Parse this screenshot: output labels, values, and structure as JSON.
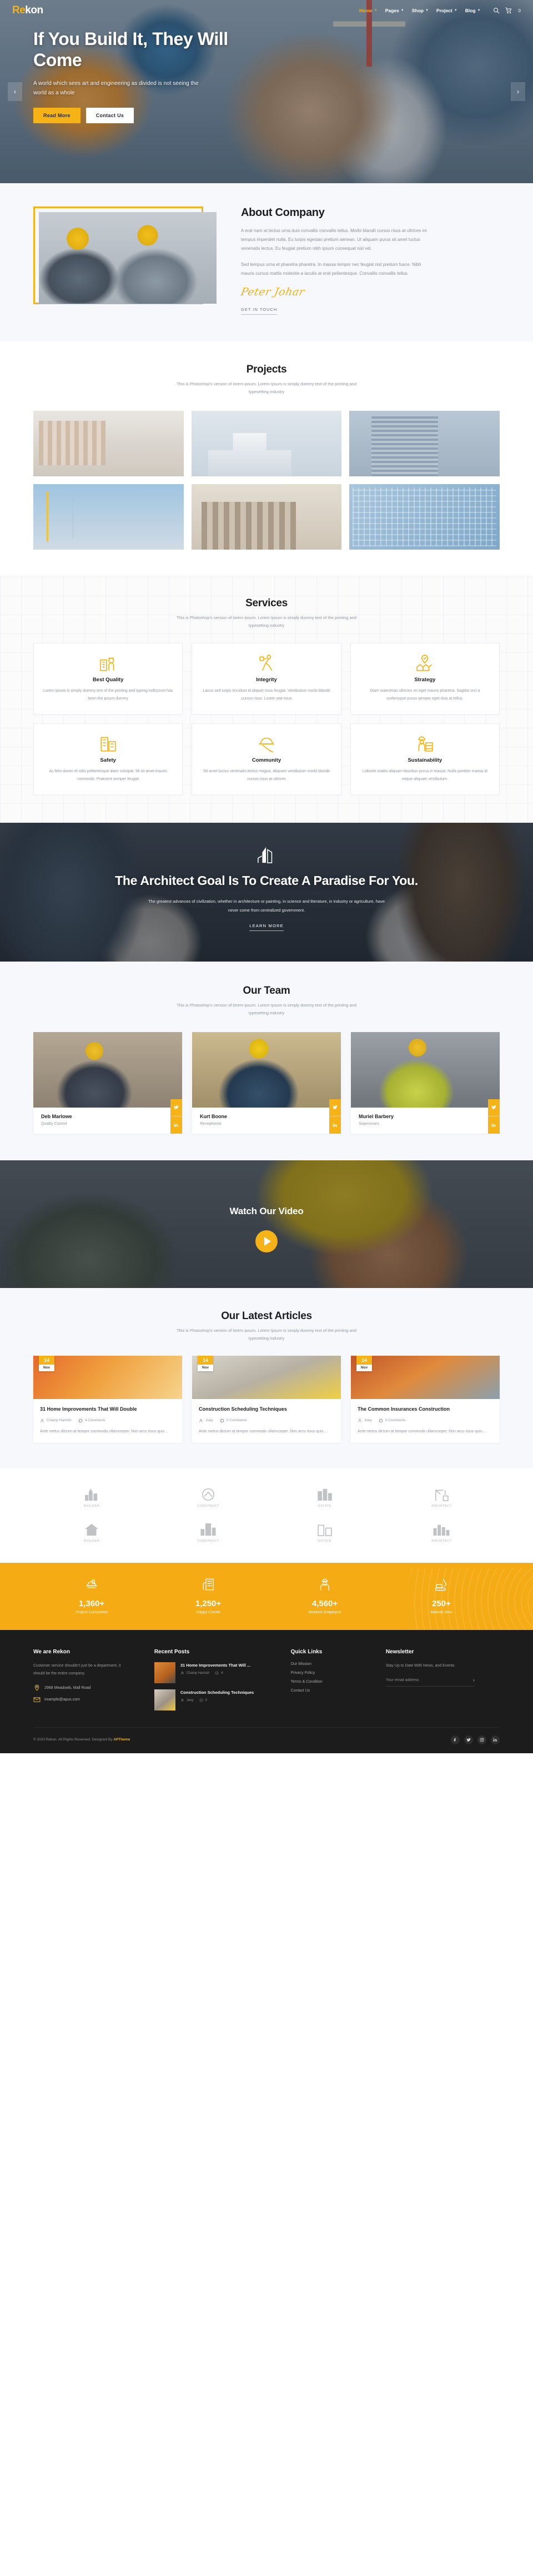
{
  "site": {
    "logo_re": "Re",
    "logo_kon": "kon"
  },
  "nav": {
    "items": [
      {
        "label": "Home",
        "has_caret": true,
        "active": true
      },
      {
        "label": "Pages",
        "has_caret": true,
        "active": false
      },
      {
        "label": "Shop",
        "has_caret": true,
        "active": false
      },
      {
        "label": "Project",
        "has_caret": true,
        "active": false
      },
      {
        "label": "Blog",
        "has_caret": true,
        "active": false
      }
    ],
    "search_icon": "search-icon",
    "cart_icon": "cart-icon",
    "cart_count": "0"
  },
  "hero": {
    "title": "If You Build It, They Will Come",
    "subtitle": "A world which sees art and engineering as divided is not seeing the world as a whole",
    "primary_button": "Read More",
    "secondary_button": "Contact Us",
    "prev_icon": "chevron-left-icon",
    "next_icon": "chevron-right-icon"
  },
  "about": {
    "title": "About Company",
    "paragraph1": "A erat nam at lectus urna duis convallis convallis tellus. Morbi blandit cursus risus at ultrices mi tempus imperdiet nulla. Eu turpis egestas pretium aenean. Ut aliquam purus sit amet luctus venenatis lectus. Eu feugiat pretium nibh ipsum consequat nisl vel.",
    "paragraph2": "Sed tempus urna et pharetra pharetra. In massa tempor nec feugiat nisl pretium fusce. Nibh mauris cursus mattis molestie a iaculis at erat pellentesque. Convallis convallis tellus.",
    "signature": "Peter Johar",
    "link": "GET IN TOUCH"
  },
  "projects": {
    "title": "Projects",
    "subtitle": "This is Photoshop's version of lorem ipsum. Lorem Ipsum is simply dummy text of the printing and typesetting industry"
  },
  "services": {
    "title": "Services",
    "subtitle": "This is Photoshop's version of lorem ipsum. Lorem Ipsum is simply dummy text of the printing and typesetting industry",
    "items": [
      {
        "icon": "engineer-building-icon",
        "name": "Best Quality",
        "text": "Lorem ipsum is simply dummy text of the printing and typesg indtrysum has been the ipsum dummy"
      },
      {
        "icon": "worker-shovel-icon",
        "name": "Integrity",
        "text": "Lacus sed turpis tincidunt id aliquet risus feugiat. Vestibulum morbi blandit cursus risus. Lorem sed risus"
      },
      {
        "icon": "location-houses-icon",
        "name": "Strategy",
        "text": "Diam maecenas ultricies mi eget mauris pharetra. Sagittis orci a scelerisque purus semper eget duis at tellus."
      },
      {
        "icon": "buildings-icon",
        "name": "Safety",
        "text": "Ac felis donec et odio pellentesque diam volutpat. Mi sit amet mauris commodo. Praesent semper feugiat"
      },
      {
        "icon": "helmet-tools-icon",
        "name": "Community",
        "text": "Sit amet luctus venenatis lectus magna. Aliquam vestibulum morbi blandit cursus risus at ultrices"
      },
      {
        "icon": "bricklayer-icon",
        "name": "Sustainability",
        "text": "Lobortis mattis aliquam faucibus purus in massa. Nulla porttitor massa id neque aliquam vestibulum."
      }
    ]
  },
  "cta": {
    "logo_icon": "building-mark-icon",
    "title": "The Architect Goal Is To Create A Paradise For You.",
    "text": "The greatest advances of civilization, whether in architecture or painting, in science and literature, in industry or agriculture, have never come from centralized government.",
    "link": "LEARN MORE"
  },
  "team": {
    "title": "Our Team",
    "subtitle": "This is Photoshop's version of lorem ipsum. Lorem Ipsum is simply dummy text of the printing and typesetting industry",
    "members": [
      {
        "name": "Deb Marlowe",
        "role": "Quality Control"
      },
      {
        "name": "Kurt Boone",
        "role": "Receptionist"
      },
      {
        "name": "Muriel Barbery",
        "role": "Supervisors"
      }
    ],
    "social_twitter": "twitter-icon",
    "social_linkedin": "linkedin-icon"
  },
  "video": {
    "title": "Watch Our Video",
    "play_icon": "play-icon"
  },
  "articles": {
    "title": "Our Latest Articles",
    "subtitle": "This is Photoshop's version of lorem ipsum. Lorem Ipsum is simply dummy text of the printing and typesetting industry",
    "items": [
      {
        "day": "14",
        "month": "Nov",
        "title": "31 Home Improvements That Will Double",
        "author": "Champ Hamish",
        "comments": "4 Comments",
        "excerpt": "Ante metus dictum at tempor commodo ullamcorper. Non arcu risus quis ..."
      },
      {
        "day": "14",
        "month": "Nov",
        "title": "Construction Scheduling Techniques",
        "author": "Joey",
        "comments": "0 Comments",
        "excerpt": "Ante metus dictum at tempor commodo ullamcorper. Non arcu risus quis ..."
      },
      {
        "day": "14",
        "month": "Nov",
        "title": "The Common Insurances Construction",
        "author": "Joey",
        "comments": "0 Comments",
        "excerpt": "Ante metus dictum at tempor commodo ullamcorper. Non arcu risus quis ..."
      }
    ]
  },
  "brands": {
    "items": [
      {
        "icon": "brand-tower-icon",
        "label": "BUILDER"
      },
      {
        "icon": "brand-mountain-icon",
        "label": "CONSTRUCT"
      },
      {
        "icon": "brand-city-icon",
        "label": "ESTATE"
      },
      {
        "icon": "brand-crane-icon",
        "label": "ARCHITECT"
      },
      {
        "icon": "brand-house-icon",
        "label": "BUILDER"
      },
      {
        "icon": "brand-tower2-icon",
        "label": "CONSTRUCT"
      },
      {
        "icon": "brand-block-icon",
        "label": "ESTATE"
      },
      {
        "icon": "brand-skyline-icon",
        "label": "ARCHITECT"
      }
    ]
  },
  "stats": {
    "items": [
      {
        "icon": "helmet-icon",
        "number": "1,360+",
        "label": "Project Completed"
      },
      {
        "icon": "building-icon",
        "number": "1,250+",
        "label": "Happy Clients"
      },
      {
        "icon": "worker-icon",
        "number": "4,560+",
        "label": "Workers Employed"
      },
      {
        "icon": "excavator-icon",
        "number": "250+",
        "label": "Awards Won"
      }
    ]
  },
  "footer": {
    "about": {
      "title": "We are Rekon",
      "text": "Customer service shouldn't just be a department, it should be the entire company.",
      "address_icon": "map-pin-icon",
      "address": "2968 Meadowb, Mall Road",
      "email_icon": "envelope-icon",
      "email": "example@apus.com"
    },
    "recent_posts": {
      "title": "Recent Posts",
      "items": [
        {
          "title": "31 Home Improvements That Will ...",
          "author": "Champ Hamish",
          "comments": "4"
        },
        {
          "title": "Construction Scheduling Techniques",
          "author": "Joey",
          "comments": "0"
        }
      ]
    },
    "quick_links": {
      "title": "Quick Links",
      "items": [
        "Our Mission",
        "Privacy Policy",
        "Terms & Condition",
        "Contact Us"
      ]
    },
    "newsletter": {
      "title": "Newsletter",
      "text": "Stay Up to Date With News, and Events",
      "placeholder": "Your email address",
      "value": "",
      "submit_icon": "chevron-right-icon"
    },
    "copyright_prefix": "© 2020 Rekon. All Rights Reserved. Designed By ",
    "copyright_brand": "APTheme",
    "socials": [
      {
        "icon": "facebook-icon"
      },
      {
        "icon": "twitter-icon"
      },
      {
        "icon": "instagram-icon"
      },
      {
        "icon": "linkedin-icon"
      }
    ]
  },
  "colors": {
    "accent": "#f5b317",
    "dark": "#1c1c1c",
    "muted": "#9196a0"
  }
}
